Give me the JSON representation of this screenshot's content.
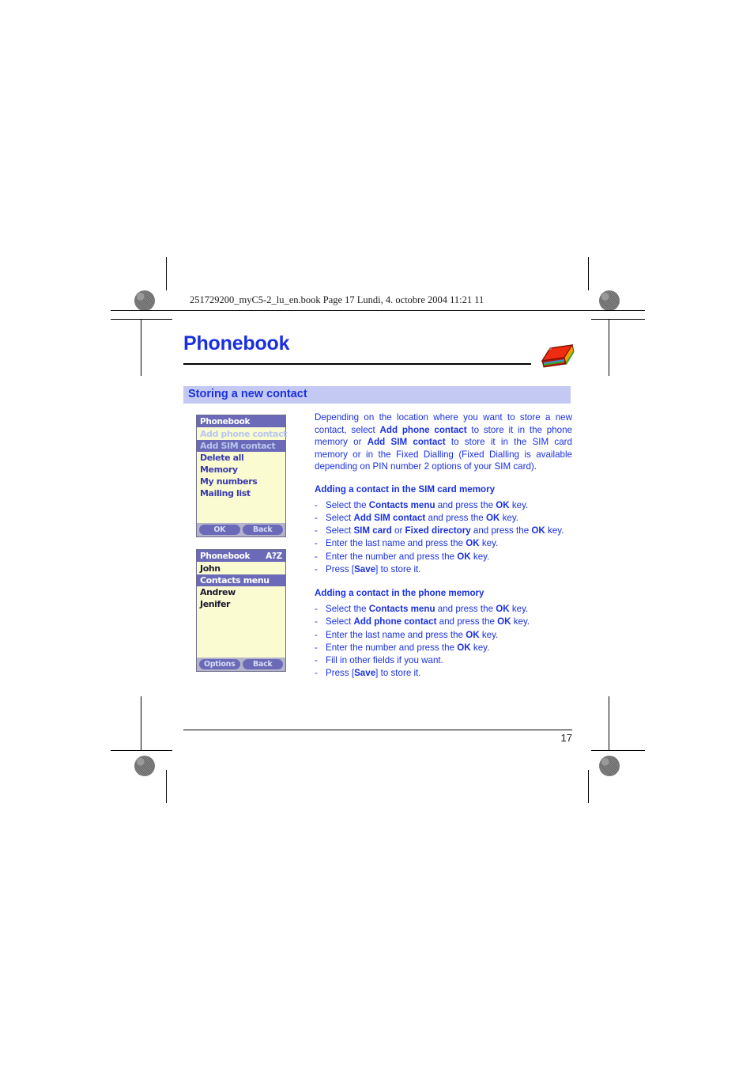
{
  "page": {
    "header_line": "251729200_myC5-2_lu_en.book  Page 17  Lundi, 4. octobre 2004  11:21 11",
    "chapter_title": "Phonebook",
    "section_title": "Storing a new contact",
    "page_number": "17",
    "book_icon": "red-book-icon"
  },
  "intro": {
    "p1_a": "Depending on the location where you want to store a new contact, select ",
    "p1_b1": "Add phone contact",
    "p1_c": " to store it in the phone memory or ",
    "p1_b2": "Add SIM contact",
    "p1_d": " to store it in the SIM card memory or in the Fixed Dialling (Fixed Dialling is available depending on PIN number 2 options of your SIM card)."
  },
  "sim_section": {
    "heading": "Adding a contact in the SIM card memory",
    "steps": [
      {
        "a": "Select the ",
        "b1": "Contacts menu",
        "c": " and press the ",
        "b2": "OK",
        "d": " key."
      },
      {
        "a": "Select ",
        "b1": "Add SIM contact",
        "c": " and press the ",
        "b2": "OK",
        "d": " key."
      },
      {
        "a": "Select ",
        "b1": "SIM card",
        "c": " or ",
        "b2": "Fixed directory",
        "d": " and press the ",
        "b3": "OK",
        "e": " key."
      },
      {
        "a": "Enter the last name and press the ",
        "b1": "OK",
        "c": " key."
      },
      {
        "a": "Enter the number and press the ",
        "b1": "OK",
        "c": " key."
      },
      {
        "a": "Press [",
        "b1": "Save",
        "c": "] to store it."
      }
    ]
  },
  "phone_section": {
    "heading": "Adding a contact in the phone memory",
    "steps": [
      {
        "a": "Select the ",
        "b1": "Contacts menu",
        "c": " and press the ",
        "b2": "OK",
        "d": " key."
      },
      {
        "a": "Select ",
        "b1": "Add phone contact",
        "c": " and press the ",
        "b2": "OK",
        "d": " key."
      },
      {
        "a": "Enter the last name and press the ",
        "b1": "OK",
        "c": " key."
      },
      {
        "a": "Enter the number and press the ",
        "b1": "OK",
        "c": " key."
      },
      {
        "a": "Fill in other fields if you want.",
        "b1": "",
        "c": ""
      },
      {
        "a": "Press [",
        "b1": "Save",
        "c": "] to store it."
      }
    ]
  },
  "screen1": {
    "title": "Phonebook",
    "title_right": "",
    "rows": [
      "Add phone contact",
      "Add SIM contact",
      "Delete all",
      "Memory",
      "My numbers",
      "Mailing list"
    ],
    "selected_index": 1,
    "softkeys": {
      "left": "OK",
      "right": "Back"
    }
  },
  "screen2": {
    "title": "Phonebook",
    "title_right": "A?Z",
    "rows": [
      "John",
      "Contacts menu",
      "Andrew",
      "Jenifer"
    ],
    "selected_index": 1,
    "softkeys": {
      "left": "Options",
      "right": "Back"
    }
  },
  "colors": {
    "link_blue": "#1a30e0",
    "band_lavender": "#c3c9f2",
    "screen_bg": "#fbfbd2",
    "screen_select": "#6a6ab8",
    "softkey": "#6a6ab8"
  }
}
